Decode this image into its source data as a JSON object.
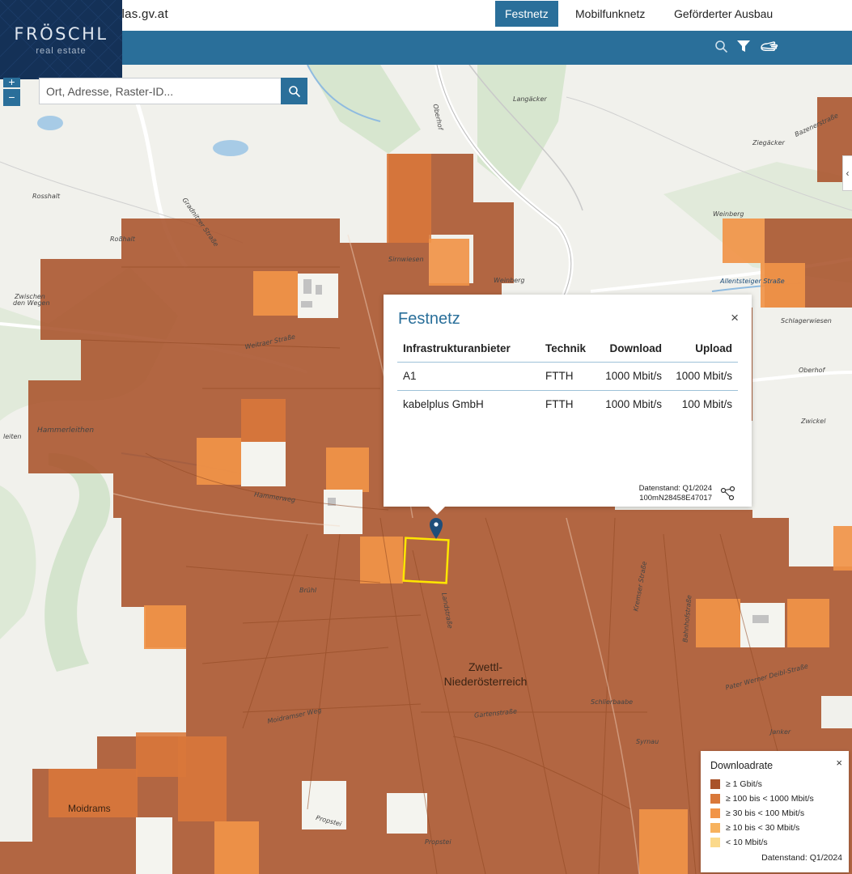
{
  "header": {
    "site_url_text": "tlas.gv.at",
    "tabs": [
      {
        "label": "Festnetz",
        "active": true
      },
      {
        "label": "Mobilfunknetz",
        "active": false
      },
      {
        "label": "Geförderter Ausbau",
        "active": false
      }
    ],
    "toolbar_icons": [
      "search-icon",
      "filter-icon",
      "hand-pointer-icon"
    ]
  },
  "logo": {
    "name": "FRÖSCHL",
    "sub": "real estate"
  },
  "map_controls": {
    "zoom_in": "+",
    "zoom_out": "−",
    "search_placeholder": "Ort, Adresse, Raster-ID...",
    "side_toggle": "‹"
  },
  "popup": {
    "title": "Festnetz",
    "close": "×",
    "columns": [
      "Infrastrukturanbieter",
      "Technik",
      "Download",
      "Upload"
    ],
    "rows": [
      [
        "A1",
        "FTTH",
        "1000 Mbit/s",
        "1000 Mbit/s"
      ],
      [
        "kabelplus GmbH",
        "FTTH",
        "1000 Mbit/s",
        "100 Mbit/s"
      ]
    ],
    "data_date": "Datenstand: Q1/2024",
    "raster_id": "100mN28458E47017"
  },
  "legend": {
    "title": "Downloadrate",
    "close": "×",
    "items": [
      {
        "label": "≥ 1 Gbit/s",
        "color": "#a9522a"
      },
      {
        "label": "≥ 100 bis < 1000 Mbit/s",
        "color": "#d9783a"
      },
      {
        "label": "≥ 30 bis < 100 Mbit/s",
        "color": "#f19448"
      },
      {
        "label": "≥ 10 bis < 30 Mbit/s",
        "color": "#f7b25e"
      },
      {
        "label": "< 10 Mbit/s",
        "color": "#fbd98b"
      }
    ],
    "data_date": "Datenstand: Q1/2024"
  },
  "map_labels": {
    "place_big": [
      "Zwettl-",
      "Niederösterreich"
    ],
    "moidrams": "Moidrams",
    "small": [
      "Langäcker",
      "Rosshalt",
      "Roßhalt",
      "Zwischen",
      "den Wegen",
      "Oberhof",
      "Weinberg",
      "Weinberg",
      "Schlagerwiesen",
      "Oberhof",
      "Zwickel",
      "leiten",
      "Hammerleithen",
      "Weitraer Straße",
      "Gradnitzer Straße",
      "Allentsteiger Straße",
      "Hammerweg",
      "Landstraße",
      "Kremser Straße",
      "Bahnhofstraße",
      "Ziegäcker",
      "Bazenerstraße",
      "Sirnwiesen",
      "Gartenstraße",
      "Propstei",
      "Propstei",
      "Moidramser Weg",
      "Pater Werner Deibl-Straße",
      "Janker",
      "Syrnau",
      "Brühl",
      "Schlierbaabe"
    ]
  },
  "colors": {
    "primary": "#2a6f9a",
    "gbit": "#a9522a",
    "mbit_100": "#d9783a",
    "mbit_30": "#f19448",
    "selection": "#ffe600",
    "marker": "#1f4e79"
  }
}
